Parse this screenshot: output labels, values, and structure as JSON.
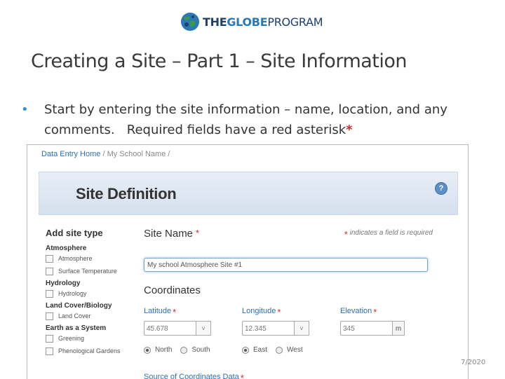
{
  "header": {
    "logo": {
      "brand_part1": "THE",
      "brand_part2": "GLOBE",
      "brand_part3": "PROGRAM",
      "icon": "globe-logo-icon"
    }
  },
  "slide": {
    "title": "Creating a Site – Part 1 – Site Information",
    "bullet_text": "Start by entering the site information – name, location, and any comments.   Required fields have a red asterisk",
    "bullet_star": "*",
    "page_number": "7/2020"
  },
  "screenshot": {
    "breadcrumb": {
      "home": "Data Entry Home",
      "sep1": "/",
      "school": "My School Name",
      "sep2": "/"
    },
    "banner_title": "Site Definition",
    "help_icon": "?",
    "sidebar": {
      "heading": "Add site type",
      "groups": [
        {
          "name": "Atmosphere",
          "items": [
            "Atmosphere",
            "Surface Temperature"
          ]
        },
        {
          "name": "Hydrology",
          "items": [
            "Hydrology"
          ]
        },
        {
          "name": "Land Cover/Biology",
          "items": [
            "Land Cover"
          ]
        },
        {
          "name": "Earth as a System",
          "items": [
            "Greening",
            "Phenological Gardens"
          ]
        }
      ]
    },
    "form": {
      "site_name_label": "Site Name",
      "required_star": "*",
      "required_note": "indicates a field is required",
      "site_name_value": "My school Atmosphere Site #1",
      "coordinates_heading": "Coordinates",
      "latitude": {
        "label": "Latitude",
        "value": "45.678",
        "dropdown": "˅"
      },
      "longitude": {
        "label": "Longitude",
        "value": "12.345",
        "dropdown": "˅"
      },
      "elevation": {
        "label": "Elevation",
        "value": "345",
        "unit": "m"
      },
      "lat_radios": [
        {
          "label": "North",
          "checked": true
        },
        {
          "label": "South",
          "checked": false
        }
      ],
      "lon_radios": [
        {
          "label": "East",
          "checked": true
        },
        {
          "label": "West",
          "checked": false
        }
      ],
      "source_label": "Source of Coordinates Data"
    }
  },
  "colors": {
    "accent_blue": "#2b6fb4",
    "required_red": "#d42a2a",
    "bullet_blue": "#3b8ed6"
  }
}
